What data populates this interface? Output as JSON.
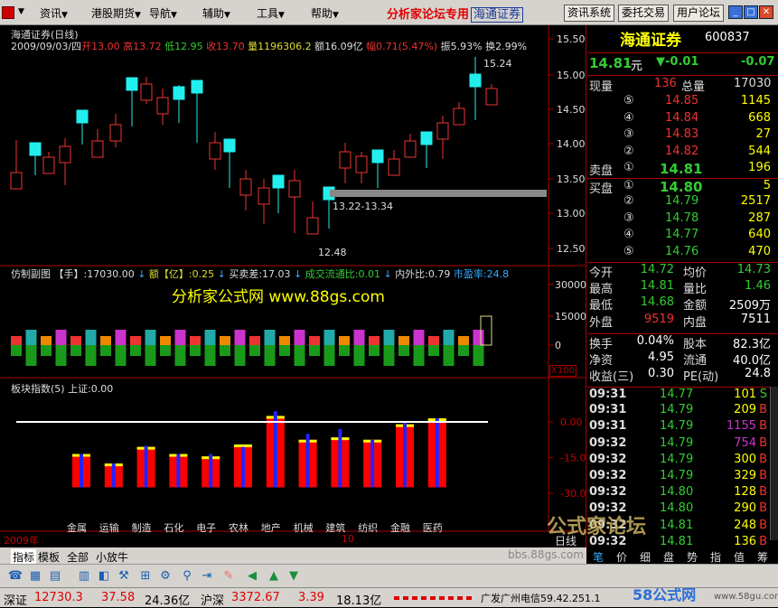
{
  "menu": {
    "items": [
      "资讯",
      "港股期货",
      "导航",
      "辅助",
      "工具",
      "帮助"
    ],
    "promo": "分析家论坛专用",
    "promo_box": "海通证券",
    "buttons": [
      "资讯系统",
      "委托交易",
      "用户论坛"
    ]
  },
  "chart": {
    "title": "海通证券(日线)",
    "date": "2009/09/03/四",
    "open_label": "开",
    "open": "13.00",
    "high_label": "高",
    "high": "13.72",
    "low_label": "低",
    "low": "12.95",
    "close_label": "收",
    "close": "13.70",
    "vol_label": "量",
    "vol": "1196306.2",
    "amt_label": "额",
    "amt": "16.09亿",
    "chg_label": "幅",
    "chg": "0.71(5.47%)",
    "amp_label": "振",
    "amp": "5.93%",
    "turn_label": "换",
    "turn": "2.99%",
    "high_mark": "15.24",
    "low_mark": "12.48",
    "range_mark": "13.22-13.34",
    "price_ticks": [
      "15.50",
      "15.00",
      "14.50",
      "14.00",
      "13.50",
      "13.00",
      "12.50"
    ]
  },
  "volume": {
    "header1": "仿制副图 【手】:17030.00",
    "amt_label": "额【亿】:0.25",
    "buysell": "买卖差:17.03",
    "circ": "成交流通比:0.01",
    "inout": "内外比:0.79",
    "pe": "市盈率:24.8",
    "watermark": "分析家公式网 www.88gs.com",
    "ticks": [
      "30000",
      "15000",
      "0"
    ],
    "unit": "X100"
  },
  "sector": {
    "header": "板块指数(5) 上证:0.00",
    "ticks": [
      "0.00",
      "-15.00",
      "-30.00"
    ],
    "names": [
      "金属",
      "运输",
      "制造",
      "石化",
      "电子",
      "农林",
      "地产",
      "机械",
      "建筑",
      "纺织",
      "金融",
      "医药"
    ],
    "values": [
      -13.5,
      -17.5,
      -10.5,
      -13.5,
      -14.5,
      -9.5,
      2.5,
      -7.5,
      -6.5,
      -7.5,
      -1,
      1.5
    ],
    "markers": [
      -13.5,
      -17.5,
      -10,
      -13.5,
      -13.5,
      -10.5,
      4.5,
      -5,
      -3,
      -7.5,
      0,
      1.5
    ]
  },
  "xaxis": {
    "year": "2009年",
    "month": "10",
    "label": "日线"
  },
  "quote": {
    "name": "海通证券",
    "code": "600837",
    "price": "14.81",
    "unit": "元",
    "change": "▼-0.01",
    "pct": "-0.07",
    "now_label": "现量",
    "now": "136",
    "tot_label": "总量",
    "tot": "17030",
    "asks": [
      {
        "lvl": "⑤",
        "price": "14.85",
        "vol": "1145"
      },
      {
        "lvl": "④",
        "price": "14.84",
        "vol": "668"
      },
      {
        "lvl": "③",
        "price": "14.83",
        "vol": "27"
      },
      {
        "lvl": "②",
        "price": "14.82",
        "vol": "544"
      },
      {
        "lvl": "①",
        "price": "14.81",
        "vol": "196",
        "label": "卖盘"
      }
    ],
    "bids": [
      {
        "lvl": "①",
        "price": "14.80",
        "vol": "5",
        "label": "买盘"
      },
      {
        "lvl": "②",
        "price": "14.79",
        "vol": "2517"
      },
      {
        "lvl": "③",
        "price": "14.78",
        "vol": "287"
      },
      {
        "lvl": "④",
        "price": "14.77",
        "vol": "640"
      },
      {
        "lvl": "⑤",
        "price": "14.76",
        "vol": "470"
      }
    ],
    "stats": [
      [
        "今开",
        "14.72",
        "均价",
        "14.73"
      ],
      [
        "最高",
        "14.81",
        "量比",
        "1.46"
      ],
      [
        "最低",
        "14.68",
        "金额",
        "2509万"
      ],
      [
        "外盘",
        "9519",
        "内盘",
        "7511"
      ]
    ],
    "stats2": [
      [
        "换手",
        "0.04%",
        "股本",
        "82.3亿"
      ],
      [
        "净资",
        "4.95",
        "流通",
        "40.0亿"
      ],
      [
        "收益(三)",
        "0.30",
        "PE(动)",
        "24.8"
      ]
    ],
    "ticks": [
      [
        "09:31",
        "14.77",
        "101",
        "S"
      ],
      [
        "09:31",
        "14.79",
        "209",
        "B"
      ],
      [
        "09:31",
        "14.79",
        "1155",
        "B"
      ],
      [
        "09:32",
        "14.79",
        "754",
        "B"
      ],
      [
        "09:32",
        "14.79",
        "300",
        "B"
      ],
      [
        "09:32",
        "14.79",
        "329",
        "B"
      ],
      [
        "09:32",
        "14.80",
        "128",
        "B"
      ],
      [
        "09:32",
        "14.80",
        "290",
        "B"
      ],
      [
        "09:32",
        "14.81",
        "248",
        "B"
      ],
      [
        "09:32",
        "14.81",
        "136",
        "B"
      ]
    ]
  },
  "tabs": {
    "bottom": [
      "指标",
      "模板",
      "全部",
      "小放牛"
    ],
    "right": [
      "笔",
      "价",
      "细",
      "盘",
      "势",
      "指",
      "值",
      "筹"
    ]
  },
  "status": {
    "sz_label": "深证",
    "sz": "12730.3",
    "sz_chg": "37.58",
    "sz_amt": "24.36亿",
    "sh_label": "沪深",
    "sh": "3372.67",
    "sh_chg": "3.39",
    "sh_amt": "18.13亿",
    "broker": "广发广州电信59.42.251.1"
  },
  "watermark2": "bbs.88gs.com",
  "logo2": "58公式网",
  "url2": "www.58gu.com",
  "forum": "公式家论坛"
}
